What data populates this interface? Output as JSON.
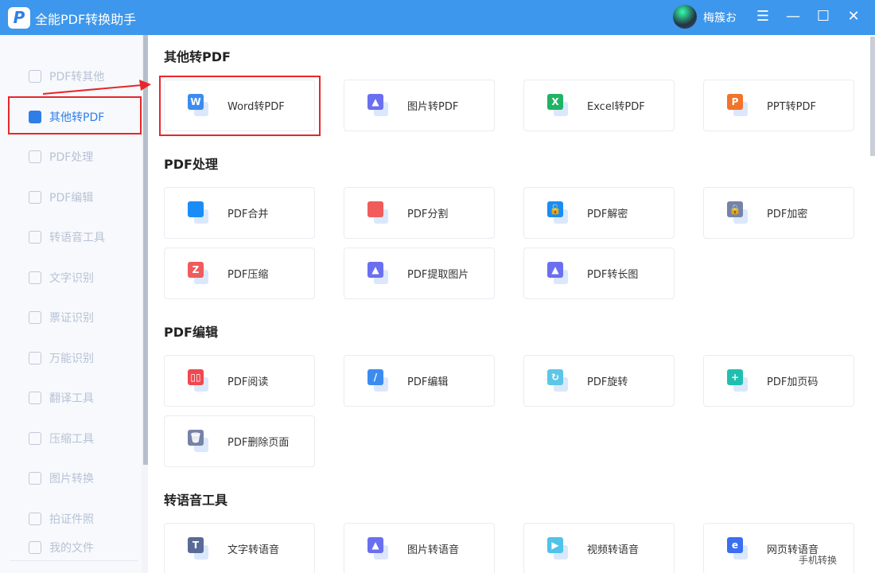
{
  "app": {
    "title": "全能PDF转换助手",
    "logo": "P",
    "user": "梅簇お"
  },
  "window": {
    "menu": "☰",
    "minimize": "—",
    "maximize": "☐",
    "close": "✕"
  },
  "sidebar": {
    "items": [
      {
        "label": "PDF转其他",
        "icon": "pdf-export-icon"
      },
      {
        "label": "其他转PDF",
        "icon": "pdf-import-icon",
        "active": true
      },
      {
        "label": "PDF处理",
        "icon": "pdf-process-icon"
      },
      {
        "label": "PDF编辑",
        "icon": "pdf-edit-icon"
      },
      {
        "label": "转语音工具",
        "icon": "tts-icon"
      },
      {
        "label": "文字识别",
        "icon": "ocr-icon"
      },
      {
        "label": "票证识别",
        "icon": "ticket-ocr-icon"
      },
      {
        "label": "万能识别",
        "icon": "universal-ocr-icon"
      },
      {
        "label": "翻译工具",
        "icon": "translate-icon"
      },
      {
        "label": "压缩工具",
        "icon": "zip-icon"
      },
      {
        "label": "图片转换",
        "icon": "image-convert-icon"
      },
      {
        "label": "拍证件照",
        "icon": "camera-icon"
      }
    ],
    "footer": "我的文件"
  },
  "sections": [
    {
      "title": "其他转PDF",
      "cards": [
        {
          "label": "Word转PDF",
          "glyph": "W",
          "color": "#3b8cf0"
        },
        {
          "label": "图片转PDF",
          "glyph": "▲",
          "color": "#6a6ff0"
        },
        {
          "label": "Excel转PDF",
          "glyph": "X",
          "color": "#1fb463"
        },
        {
          "label": "PPT转PDF",
          "glyph": "P",
          "color": "#f2742a"
        }
      ]
    },
    {
      "title": "PDF处理",
      "cards": [
        {
          "label": "PDF合并",
          "glyph": "",
          "color": "#1a8cf5"
        },
        {
          "label": "PDF分割",
          "glyph": "",
          "color": "#f05b5b"
        },
        {
          "label": "PDF解密",
          "glyph": "🔓",
          "color": "#1a8cf5"
        },
        {
          "label": "PDF加密",
          "glyph": "🔒",
          "color": "#7782a8"
        },
        {
          "label": "PDF压缩",
          "glyph": "Z",
          "color": "#f05b5b"
        },
        {
          "label": "PDF提取图片",
          "glyph": "▲",
          "color": "#6a6ff0"
        },
        {
          "label": "PDF转长图",
          "glyph": "▲",
          "color": "#6a6ff0"
        }
      ]
    },
    {
      "title": "PDF编辑",
      "cards": [
        {
          "label": "PDF阅读",
          "glyph": "▯▯",
          "color": "#f0484f"
        },
        {
          "label": "PDF编辑",
          "glyph": "/",
          "color": "#3b8cf0"
        },
        {
          "label": "PDF旋转",
          "glyph": "↻",
          "color": "#5cc6e8"
        },
        {
          "label": "PDF加页码",
          "glyph": "+",
          "color": "#1fbfb0"
        },
        {
          "label": "PDF删除页面",
          "glyph": "🗑",
          "color": "#7782a8"
        }
      ]
    },
    {
      "title": "转语音工具",
      "cards": [
        {
          "label": "文字转语音",
          "glyph": "T",
          "color": "#5a6a96"
        },
        {
          "label": "图片转语音",
          "glyph": "▲",
          "color": "#6a6ff0"
        },
        {
          "label": "视频转语音",
          "glyph": "▶",
          "color": "#4fc3e8"
        },
        {
          "label": "网页转语音",
          "glyph": "e",
          "color": "#3b6ef0"
        }
      ]
    }
  ],
  "watermark": "手机转换"
}
